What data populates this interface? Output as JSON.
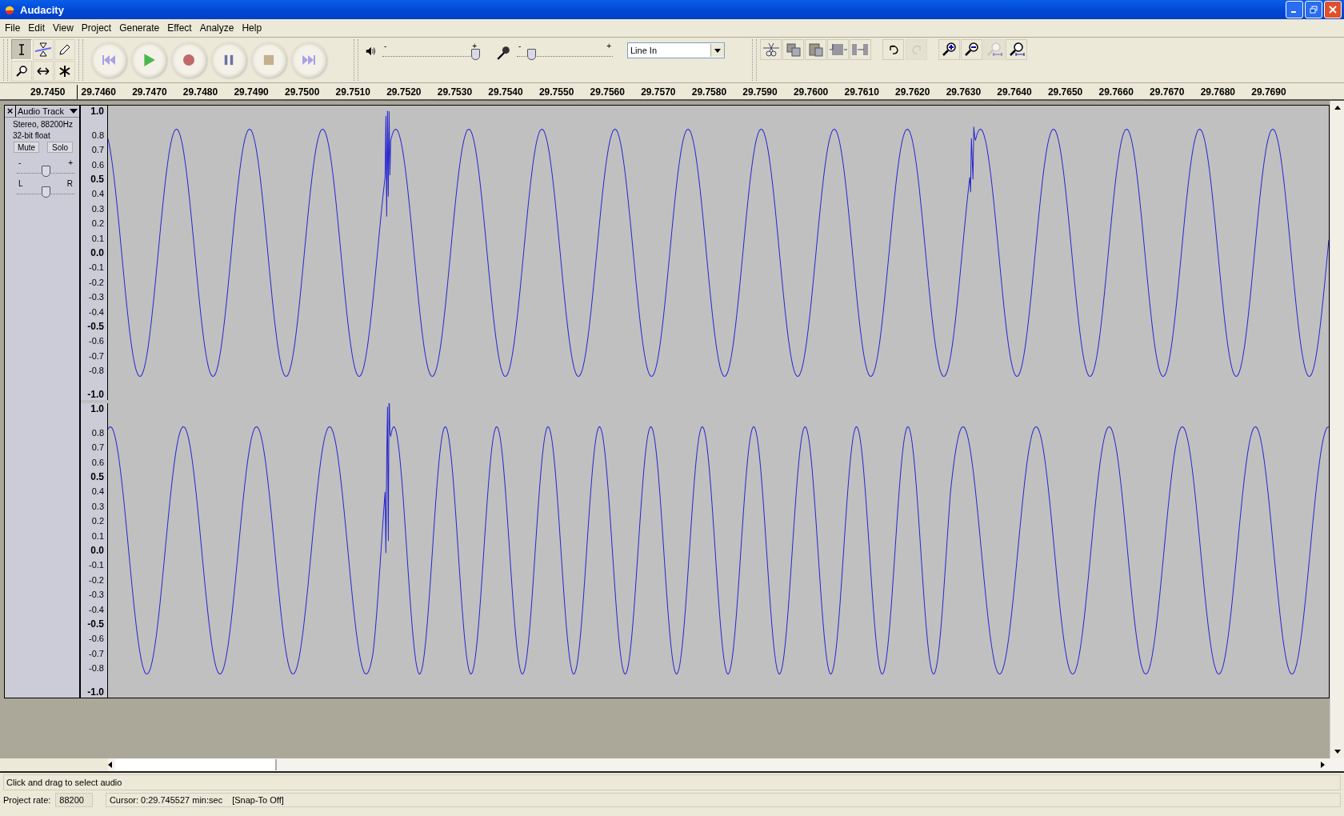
{
  "window": {
    "title": "Audacity"
  },
  "menu": [
    "File",
    "Edit",
    "View",
    "Project",
    "Generate",
    "Effect",
    "Analyze",
    "Help"
  ],
  "tools": [
    {
      "kind": "select",
      "selected": true
    },
    {
      "kind": "envelope",
      "selected": false
    },
    {
      "kind": "draw",
      "selected": false
    },
    {
      "kind": "zoom",
      "selected": false
    },
    {
      "kind": "timeshift",
      "selected": false
    },
    {
      "kind": "multi",
      "selected": false
    }
  ],
  "transport": [
    {
      "kind": "rewind"
    },
    {
      "kind": "play"
    },
    {
      "kind": "record"
    },
    {
      "kind": "pause"
    },
    {
      "kind": "stop"
    },
    {
      "kind": "end"
    }
  ],
  "mixer": {
    "playback": {
      "level": 0.97,
      "minus": "-",
      "plus": "+"
    },
    "recording": {
      "level": 0.15,
      "minus": "-",
      "plus": "+"
    },
    "input_source": "Line In"
  },
  "edit_tools": [
    {
      "kind": "trim",
      "disabled": false
    },
    {
      "kind": "copy",
      "disabled": false
    },
    {
      "kind": "paste",
      "disabled": false
    },
    {
      "kind": "trim-audio",
      "disabled": false
    },
    {
      "kind": "silence",
      "disabled": false
    }
  ],
  "history": [
    {
      "kind": "undo",
      "disabled": false
    },
    {
      "kind": "redo",
      "disabled": true
    }
  ],
  "zoom_tools": [
    {
      "kind": "zoom-in",
      "disabled": false
    },
    {
      "kind": "zoom-out",
      "disabled": false
    },
    {
      "kind": "fit-selection",
      "disabled": true
    },
    {
      "kind": "fit-project",
      "disabled": false
    }
  ],
  "timeline": [
    "29.7450",
    "29.7460",
    "29.7470",
    "29.7480",
    "29.7490",
    "29.7500",
    "29.7510",
    "29.7520",
    "29.7530",
    "29.7540",
    "29.7550",
    "29.7560",
    "29.7570",
    "29.7580",
    "29.7590",
    "29.7600",
    "29.7610",
    "29.7620",
    "29.7630",
    "29.7640",
    "29.7650",
    "29.7660",
    "29.7670",
    "29.7680",
    "29.7690"
  ],
  "track": {
    "close": "×",
    "name": "Audio Track",
    "info": [
      "Stereo, 88200Hz",
      "32-bit float"
    ],
    "mute": "Mute",
    "solo": "Solo",
    "gain": {
      "level": 0.5,
      "minus": "-",
      "plus": "+"
    },
    "pan": {
      "level": 0.5,
      "left": "L",
      "right": "R"
    },
    "channels": [
      {
        "scale": [
          {
            "label": "1.0",
            "major": true
          },
          {
            "label": "0.8",
            "major": false
          },
          {
            "label": "0.7",
            "major": false
          },
          {
            "label": "0.6",
            "major": false
          },
          {
            "label": "0.5",
            "major": true
          },
          {
            "label": "0.4",
            "major": false
          },
          {
            "label": "0.3",
            "major": false
          },
          {
            "label": "0.2",
            "major": false
          },
          {
            "label": "0.1",
            "major": false
          },
          {
            "label": "0.0",
            "major": true
          },
          {
            "label": "-0.1",
            "major": false
          },
          {
            "label": "-0.2",
            "major": false
          },
          {
            "label": "-0.3",
            "major": false
          },
          {
            "label": "-0.4",
            "major": false
          },
          {
            "label": "-0.5",
            "major": true
          },
          {
            "label": "-0.6",
            "major": false
          },
          {
            "label": "-0.7",
            "major": false
          },
          {
            "label": "-0.8",
            "major": false
          },
          {
            "label": "-1.0",
            "major": true
          }
        ]
      },
      {
        "scale": [
          {
            "label": "1.0",
            "major": true
          },
          {
            "label": "0.8",
            "major": false
          },
          {
            "label": "0.7",
            "major": false
          },
          {
            "label": "0.6",
            "major": false
          },
          {
            "label": "0.5",
            "major": true
          },
          {
            "label": "0.4",
            "major": false
          },
          {
            "label": "0.3",
            "major": false
          },
          {
            "label": "0.2",
            "major": false
          },
          {
            "label": "0.1",
            "major": false
          },
          {
            "label": "0.0",
            "major": true
          },
          {
            "label": "-0.1",
            "major": false
          },
          {
            "label": "-0.2",
            "major": false
          },
          {
            "label": "-0.3",
            "major": false
          },
          {
            "label": "-0.4",
            "major": false
          },
          {
            "label": "-0.5",
            "major": true
          },
          {
            "label": "-0.6",
            "major": false
          },
          {
            "label": "-0.7",
            "major": false
          },
          {
            "label": "-0.8",
            "major": false
          },
          {
            "label": "-1.0",
            "major": true
          }
        ]
      }
    ]
  },
  "status": {
    "message": "Click and drag to select audio",
    "rate_label": "Project rate:",
    "rate": "88200",
    "cursor": "Cursor: 0:29.745527 min:sec",
    "snap": "[Snap-To Off]"
  }
}
